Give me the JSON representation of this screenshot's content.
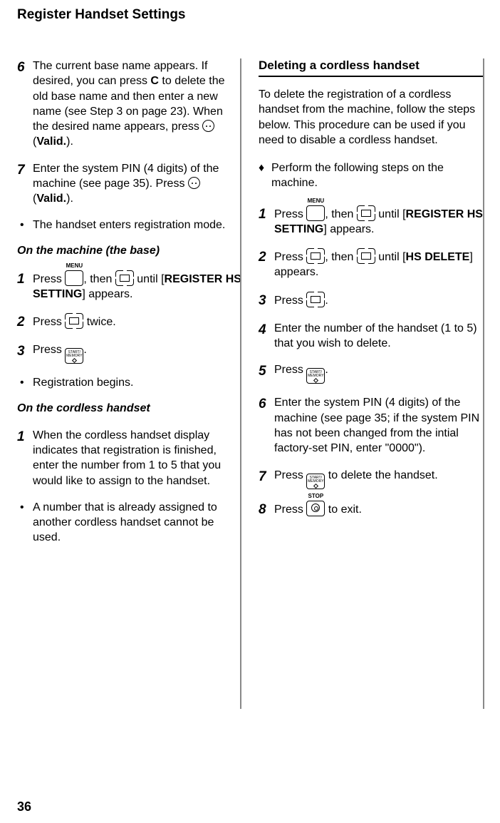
{
  "title": "Register Handset Settings",
  "pageNumber": "36",
  "left": {
    "step6": {
      "text": "The current base name appears. If desired, you can press ",
      "c": "C",
      "text2": " to delete the old base name and then enter a new name (see Step 3 on page 23). When the desired name appears, press ",
      "valid": "Valid.",
      "text3": ")."
    },
    "step7": {
      "text": "Enter the system PIN (4 digits) of the machine (see page 35). Press ",
      "valid": "Valid.",
      "text2": ")."
    },
    "bullet1": "The handset enters registration mode.",
    "sub1": "On the machine (the base)",
    "m_step1": {
      "pressA": "Press ",
      "menu": "MENU",
      "then": ", then ",
      "until": " until [",
      "setting": "REGISTER HS SETTING",
      "appears": "] appears."
    },
    "m_step2": {
      "pressA": "Press ",
      "twice": " twice."
    },
    "m_step3": {
      "pressA": "Press ",
      "dot": "."
    },
    "bullet2": "Registration begins.",
    "sub2": "On the cordless handset",
    "h_step1": "When the cordless handset display indicates that registration is finished, enter the number from 1 to 5 that you would like to assign to the handset.",
    "bullet3": "A number that is already assigned to another cordless handset cannot be used."
  },
  "right": {
    "heading": "Deleting a cordless handset",
    "intro": "To delete the registration of a cordless handset from the machine, follow the steps below. This procedure can be used if you need to disable a cordless handset.",
    "diamond": "Perform the following steps on the machine.",
    "step1": {
      "pressA": "Press ",
      "menu": "MENU",
      "then": ", then ",
      "until": " until [",
      "setting": "REGISTER HS SETTING",
      "appears": "] appears."
    },
    "step2": {
      "pressA": "Press ",
      "then": ", then ",
      "until": " until [",
      "hsdel": "HS DELETE",
      "appears": "] appears."
    },
    "step3": {
      "pressA": "Press ",
      "dot": "."
    },
    "step4": "Enter the number of the handset (1 to 5) that you wish to delete.",
    "step5": {
      "pressA": "Press ",
      "dot": "."
    },
    "step6": "Enter the system PIN (4 digits) of the machine (see page 35; if the system PIN has not been changed from the intial factory-set PIN, enter \"0000\").",
    "step7": {
      "pressA": "Press ",
      "rest": " to delete the handset."
    },
    "step8": {
      "pressA": "Press ",
      "stop": "STOP",
      "rest": " to exit."
    }
  }
}
